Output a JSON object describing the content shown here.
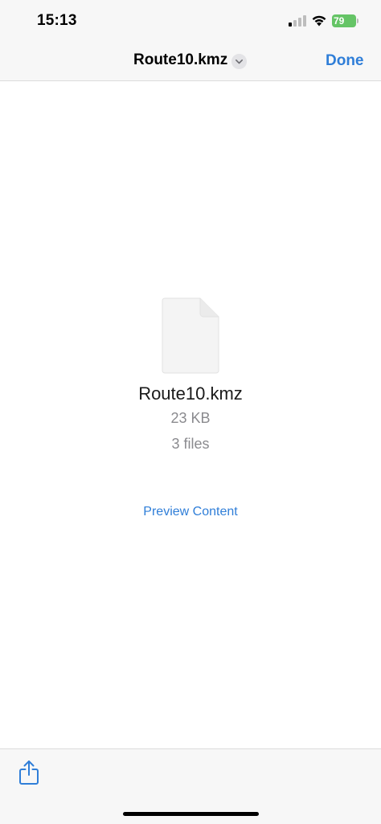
{
  "status_bar": {
    "time": "15:13",
    "battery_level": "79",
    "cellular_bars_active": 1,
    "cellular_bars_total": 4,
    "battery_color": "#65c466"
  },
  "nav": {
    "title": "Route10.kmz",
    "done_label": "Done",
    "accent_color": "#2f7ed8"
  },
  "file": {
    "icon": "blank-document-icon",
    "name": "Route10.kmz",
    "size": "23 KB",
    "count": "3 files"
  },
  "actions": {
    "preview_label": "Preview Content"
  },
  "toolbar": {
    "share_icon": "share-icon"
  }
}
